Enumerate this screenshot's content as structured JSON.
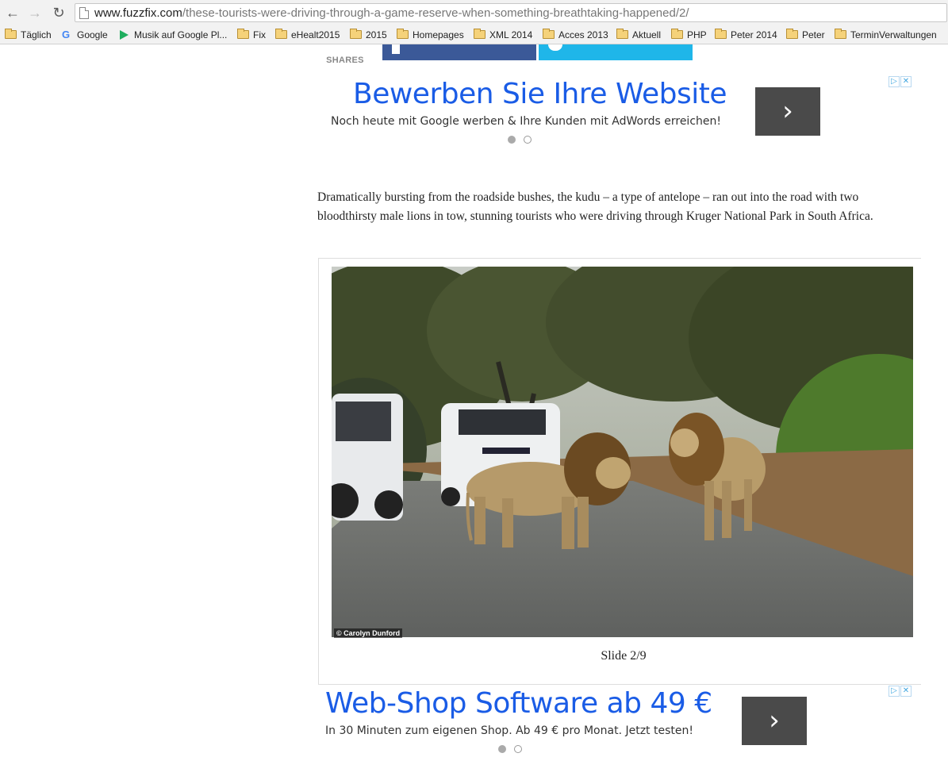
{
  "browser": {
    "url_host": "www.fuzzfix.com",
    "url_path": "/these-tourists-were-driving-through-a-game-reserve-when-something-breathtaking-happened/2/",
    "bookmarks": [
      {
        "label": "Täglich",
        "icon": "folder-icon"
      },
      {
        "label": "Google",
        "icon": "google-icon"
      },
      {
        "label": "Musik auf Google Pl...",
        "icon": "google-play-icon"
      },
      {
        "label": "Fix",
        "icon": "folder-icon"
      },
      {
        "label": "eHealt2015",
        "icon": "folder-icon"
      },
      {
        "label": "2015",
        "icon": "folder-icon"
      },
      {
        "label": "Homepages",
        "icon": "folder-icon"
      },
      {
        "label": "XML 2014",
        "icon": "folder-icon"
      },
      {
        "label": "Acces 2013",
        "icon": "folder-icon"
      },
      {
        "label": "Aktuell",
        "icon": "folder-icon"
      },
      {
        "label": "PHP",
        "icon": "folder-icon"
      },
      {
        "label": "Peter 2014",
        "icon": "folder-icon"
      },
      {
        "label": "Peter",
        "icon": "folder-icon"
      },
      {
        "label": "TerminVerwaltungen",
        "icon": "folder-icon"
      }
    ]
  },
  "share": {
    "label": "SHARES",
    "facebook_color": "#3b5998",
    "twitter_color": "#1fb6e9"
  },
  "ad_top": {
    "title": "Bewerben Sie Ihre Website",
    "text": "Noch heute mit Google werben & Ihre Kunden mit AdWords erreichen!",
    "arrow": "›"
  },
  "article": {
    "paragraph": "Dramatically bursting from the roadside bushes, the kudu – a type of antelope – ran out into the road with two bloodthirsty male lions in tow, stunning tourists who were driving through Kruger National Park in South Africa."
  },
  "slide": {
    "credit": "© Carolyn Dunford",
    "caption": "Slide 2/9"
  },
  "ad_bottom": {
    "title": "Web-Shop Software ab 49 €",
    "text": "In 30 Minuten zum eigenen Shop. Ab 49 € pro Monat. Jetzt testen!",
    "arrow": "›"
  },
  "colors": {
    "ad_link": "#1a5ce6",
    "ad_arrow_bg": "#4a4a4a"
  }
}
